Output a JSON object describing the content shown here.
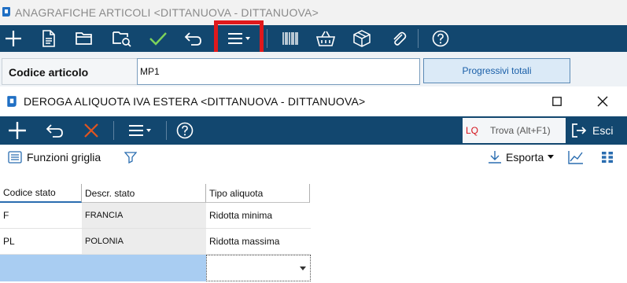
{
  "background_window": {
    "title": "ANAGRAFICHE ARTICOLI <DITTANUOVA - DITTANUOVA>",
    "toolbar_icons": [
      "plus-icon",
      "new-document-icon",
      "folder-open-icon",
      "folder-search-icon",
      "check-icon",
      "undo-icon",
      "hamburger-menu-icon",
      "barcode-icon",
      "basket-icon",
      "package-icon",
      "paperclip-icon",
      "help-icon"
    ],
    "code_label": "Codice articolo",
    "code_value": "MP1",
    "progressivi_button": "Progressivi totali"
  },
  "dialog": {
    "title": "DEROGA ALIQUOTA IVA ESTERA <DITTANUOVA - DITTANUOVA>",
    "search_prefix": "LQ",
    "search_placeholder": "Trova (Alt+F1)",
    "exit_label": "Esci",
    "grid_functions_label": "Funzioni griglia",
    "export_label": "Esporta",
    "table": {
      "headers": [
        "Codice stato",
        "Descr. stato",
        "Tipo aliquota"
      ],
      "rows": [
        [
          "F",
          "FRANCIA",
          "Ridotta minima"
        ],
        [
          "PL",
          "POLONIA",
          "Ridotta massima"
        ]
      ]
    }
  },
  "colors": {
    "toolbar_bg": "#12476f",
    "highlight_red": "#e0191c",
    "selected_row": "#a9cdf2",
    "readonly_cell": "#ececec"
  }
}
